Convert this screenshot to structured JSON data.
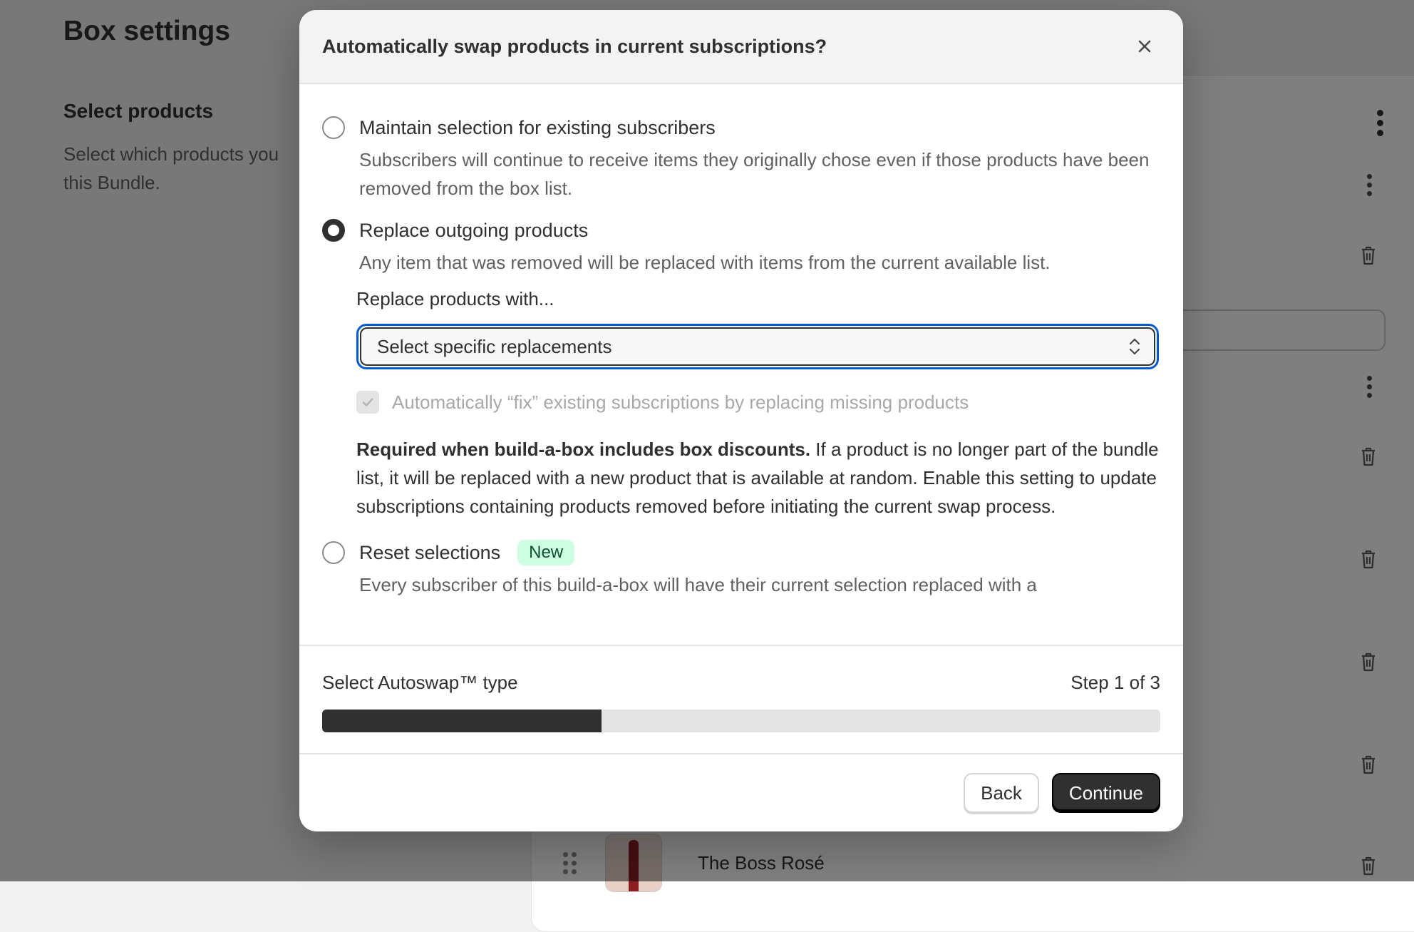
{
  "background": {
    "page_title": "Box settings",
    "section_title": "Select products",
    "section_description": "Select which products you this Bundle.",
    "product": {
      "name": "The Boss Rosé"
    }
  },
  "modal": {
    "title": "Automatically swap products in current subscriptions?",
    "close_icon": "close-icon",
    "options": [
      {
        "label": "Maintain selection for existing subscribers",
        "description": "Subscribers will continue to receive items they originally chose even if those products have been removed from the box list.",
        "selected": false
      },
      {
        "label": "Replace outgoing products",
        "description": "Any item that was removed will be replaced with items from the current available list.",
        "selected": true
      },
      {
        "label": "Reset selections",
        "badge": "New",
        "description": "Every subscriber of this build-a-box will have their current selection replaced with a",
        "selected": false
      }
    ],
    "replace": {
      "label": "Replace products with...",
      "selected_value": "Select specific replacements",
      "checkbox_label": "Automatically “fix” existing subscriptions by replacing missing products",
      "checkbox_checked": true,
      "checkbox_disabled": true,
      "note_bold": "Required when build-a-box includes box discounts.",
      "note_text": " If a product is no longer part of the bundle list, it will be replaced with a new product that is available at random. Enable this setting to update subscriptions containing products removed before initiating the current swap process."
    },
    "progress": {
      "label": "Select Autoswap™ type",
      "step_text": "Step 1 of 3",
      "fraction": 0.333
    },
    "buttons": {
      "back": "Back",
      "continue": "Continue"
    }
  },
  "colors": {
    "focus": "#005bd3",
    "badge_bg": "#cdfee1",
    "badge_text": "#0c5132",
    "primary": "#303030"
  }
}
